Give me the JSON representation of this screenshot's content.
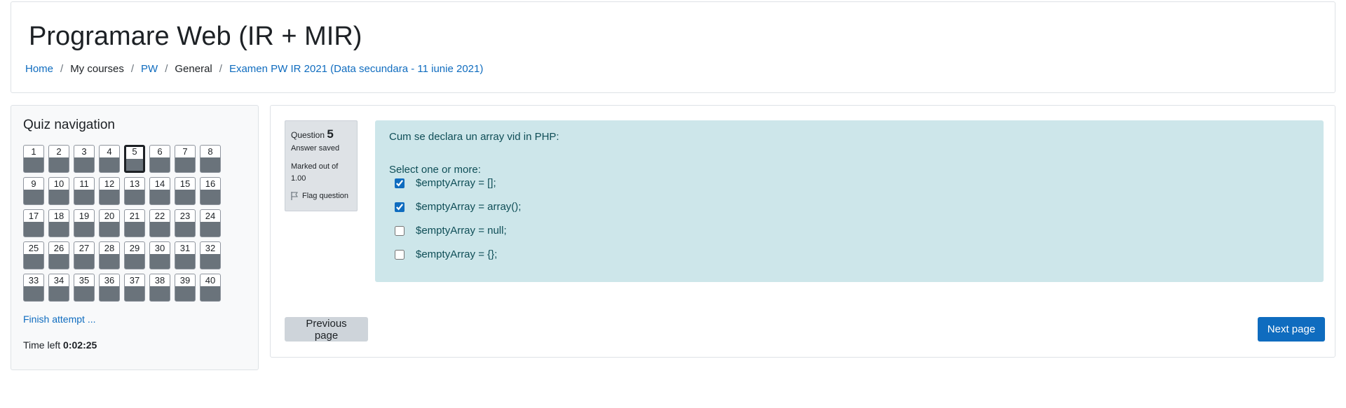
{
  "header": {
    "title": "Programare Web (IR + MIR)",
    "breadcrumb": [
      "Home",
      "My courses",
      "PW",
      "General",
      "Examen PW IR 2021 (Data secundara - 11 iunie 2021)"
    ]
  },
  "quiz_nav": {
    "title": "Quiz navigation",
    "questions": [
      "1",
      "2",
      "3",
      "4",
      "5",
      "6",
      "7",
      "8",
      "9",
      "10",
      "11",
      "12",
      "13",
      "14",
      "15",
      "16",
      "17",
      "18",
      "19",
      "20",
      "21",
      "22",
      "23",
      "24",
      "25",
      "26",
      "27",
      "28",
      "29",
      "30",
      "31",
      "32",
      "33",
      "34",
      "35",
      "36",
      "37",
      "38",
      "39",
      "40"
    ],
    "current": "5",
    "finish_label": "Finish attempt ...",
    "time_left_label": "Time left",
    "time_left_value": "0:02:25"
  },
  "question": {
    "label": "Question",
    "number": "5",
    "state": "Answer saved",
    "grade_text": "Marked out of",
    "grade_value": "1.00",
    "flag_label": "Flag question",
    "text": "Cum se declara un array vid in PHP:",
    "prompt": "Select one or more:",
    "answers": [
      {
        "text": "$emptyArray = [];",
        "checked": true
      },
      {
        "text": "$emptyArray = array();",
        "checked": true
      },
      {
        "text": "$emptyArray = null;",
        "checked": false
      },
      {
        "text": "$emptyArray = {};",
        "checked": false
      }
    ]
  },
  "buttons": {
    "previous": "Previous page",
    "next": "Next page"
  },
  "colors": {
    "link": "#0f6cbf",
    "question_bg": "#cde6ea",
    "info_bg": "#dee2e6",
    "primary": "#0f6cbf",
    "secondary": "#ced4da"
  },
  "icons": {
    "flag": "flag-icon"
  }
}
